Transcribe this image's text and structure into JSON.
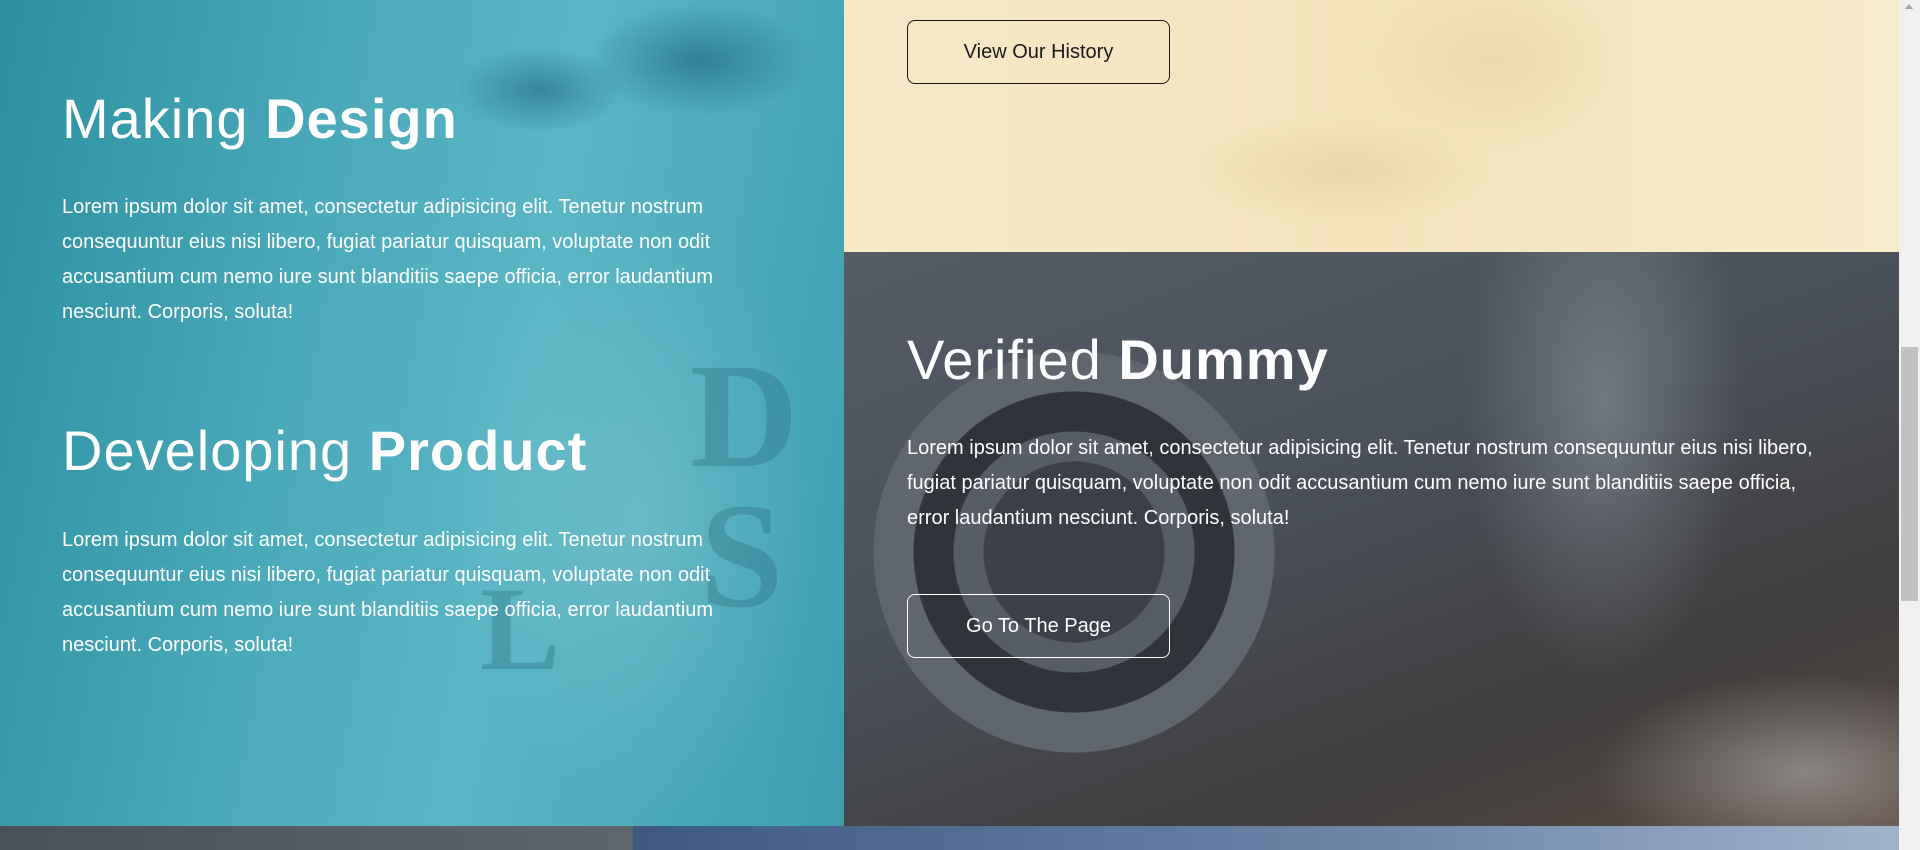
{
  "sections": {
    "making_design": {
      "title_light": "Making",
      "title_bold": "Design",
      "body": "Lorem ipsum dolor sit amet, consectetur adipisicing elit. Tenetur nostrum consequuntur eius nisi libero, fugiat pariatur quisquam, voluptate non odit accusantium cum nemo iure sunt blanditiis saepe officia, error laudantium nesciunt. Corporis, soluta!"
    },
    "developing_product": {
      "title_light": "Developing",
      "title_bold": "Product",
      "body": "Lorem ipsum dolor sit amet, consectetur adipisicing elit. Tenetur nostrum consequuntur eius nisi libero, fugiat pariatur quisquam, voluptate non odit accusantium cum nemo iure sunt blanditiis saepe officia, error laudantium nesciunt. Corporis, soluta!"
    },
    "history": {
      "button_label": "View Our History"
    },
    "verified_dummy": {
      "title_light": "Verified",
      "title_bold": "Dummy",
      "body": "Lorem ipsum dolor sit amet, consectetur adipisicing elit. Tenetur nostrum consequuntur eius nisi libero, fugiat pariatur quisquam, voluptate non odit accusantium cum nemo iure sunt blanditiis saepe officia, error laudantium nesciunt. Corporis, soluta!",
      "button_label": "Go To The Page"
    }
  },
  "colors": {
    "teal_overlay": "#4aa9ba",
    "cream_overlay": "#f7e9c6",
    "slate_overlay": "#4a515b",
    "light_text": "#ffffff",
    "dark_text": "#1a1a1a"
  }
}
